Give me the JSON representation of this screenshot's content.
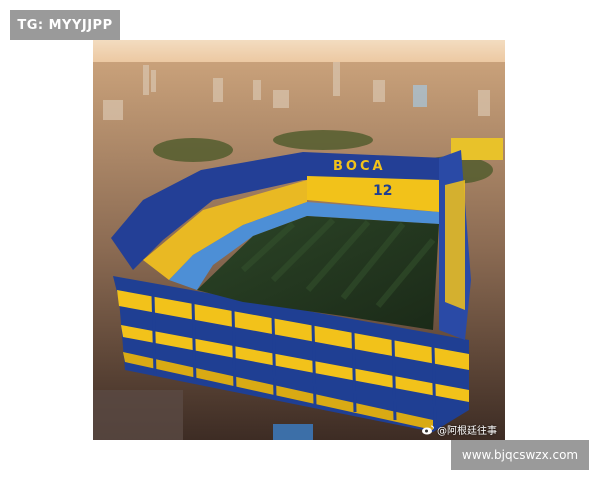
{
  "top_badge": {
    "text": "TG: MYYJJPP"
  },
  "photo": {
    "subject": "aerial view of a blue and yellow football stadium in a city at sunset",
    "stand_lettering": "BOCA",
    "stand_number": "12",
    "watermark": "@阿根廷往事",
    "colors": {
      "blue": "#1f3f93",
      "yellow": "#f2c21a",
      "pitch": "#243a22",
      "sky": "#e8c9a0"
    }
  },
  "bottom_badge": {
    "text": "www.bjqcswzx.com"
  }
}
